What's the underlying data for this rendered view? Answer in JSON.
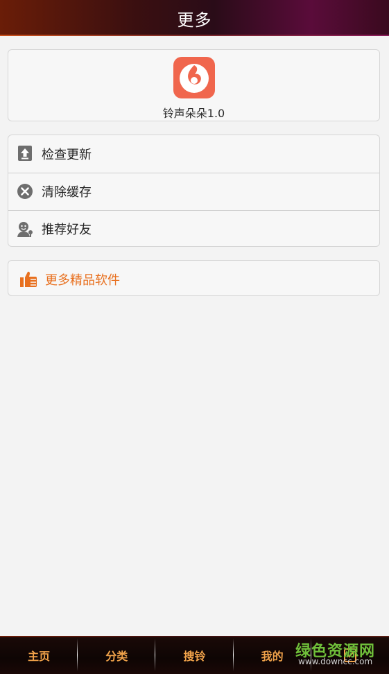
{
  "header": {
    "title": "更多"
  },
  "app": {
    "name": "铃声朵朵1.0",
    "icon": "music-note-icon",
    "icon_color": "#f0664d"
  },
  "menu": {
    "items": [
      {
        "label": "检查更新",
        "icon": "upload-update-icon"
      },
      {
        "label": "清除缓存",
        "icon": "clear-circle-x-icon"
      },
      {
        "label": "推荐好友",
        "icon": "recommend-friend-icon"
      }
    ]
  },
  "more": {
    "label": "更多精品软件",
    "icon": "thumbs-up-icon",
    "color": "#e8701f"
  },
  "bottom_nav": {
    "tabs": [
      {
        "label": "主页"
      },
      {
        "label": "分类"
      },
      {
        "label": "搜铃"
      },
      {
        "label": "我的"
      },
      {
        "label": "",
        "icon": "more-icon"
      }
    ],
    "active_color": "#f0a24a"
  },
  "watermark": {
    "text": "绿色资源网",
    "url": "www.downcc.com"
  }
}
